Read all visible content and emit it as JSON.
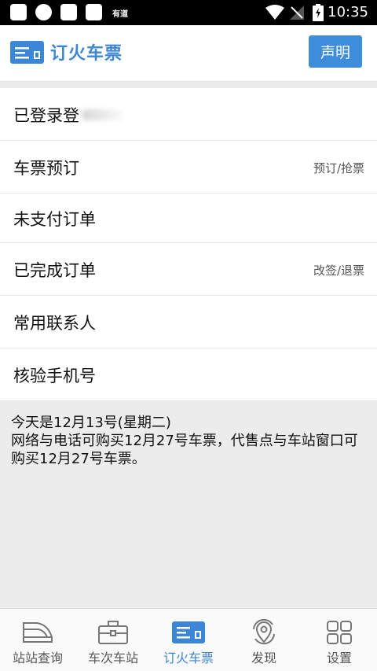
{
  "status_bar": {
    "notification_text": "有道",
    "time": "10:35"
  },
  "header": {
    "title": "订火车票",
    "statement_button": "声明"
  },
  "menu": {
    "items": [
      {
        "label": "已登录登",
        "hint": ""
      },
      {
        "label": "车票预订",
        "hint": "预订/抢票"
      },
      {
        "label": "未支付订单",
        "hint": ""
      },
      {
        "label": "已完成订单",
        "hint": "改签/退票"
      },
      {
        "label": "常用联系人",
        "hint": ""
      },
      {
        "label": "核验手机号",
        "hint": ""
      }
    ]
  },
  "notice": {
    "line1": "今天是12月13号(星期二)",
    "line2": "网络与电话可购买12月27号车票，代售点与车站窗口可购买12月27号车票。"
  },
  "bottom_nav": {
    "items": [
      {
        "label": "站站查询",
        "icon": "train-icon"
      },
      {
        "label": "车次车站",
        "icon": "briefcase-icon"
      },
      {
        "label": "订火车票",
        "icon": "ticket-icon"
      },
      {
        "label": "发现",
        "icon": "compass-location-icon"
      },
      {
        "label": "设置",
        "icon": "grid-icon"
      }
    ],
    "active_index": 2
  },
  "colors": {
    "accent": "#3b86d6",
    "button": "#3d8ddb",
    "background": "#ececec"
  }
}
